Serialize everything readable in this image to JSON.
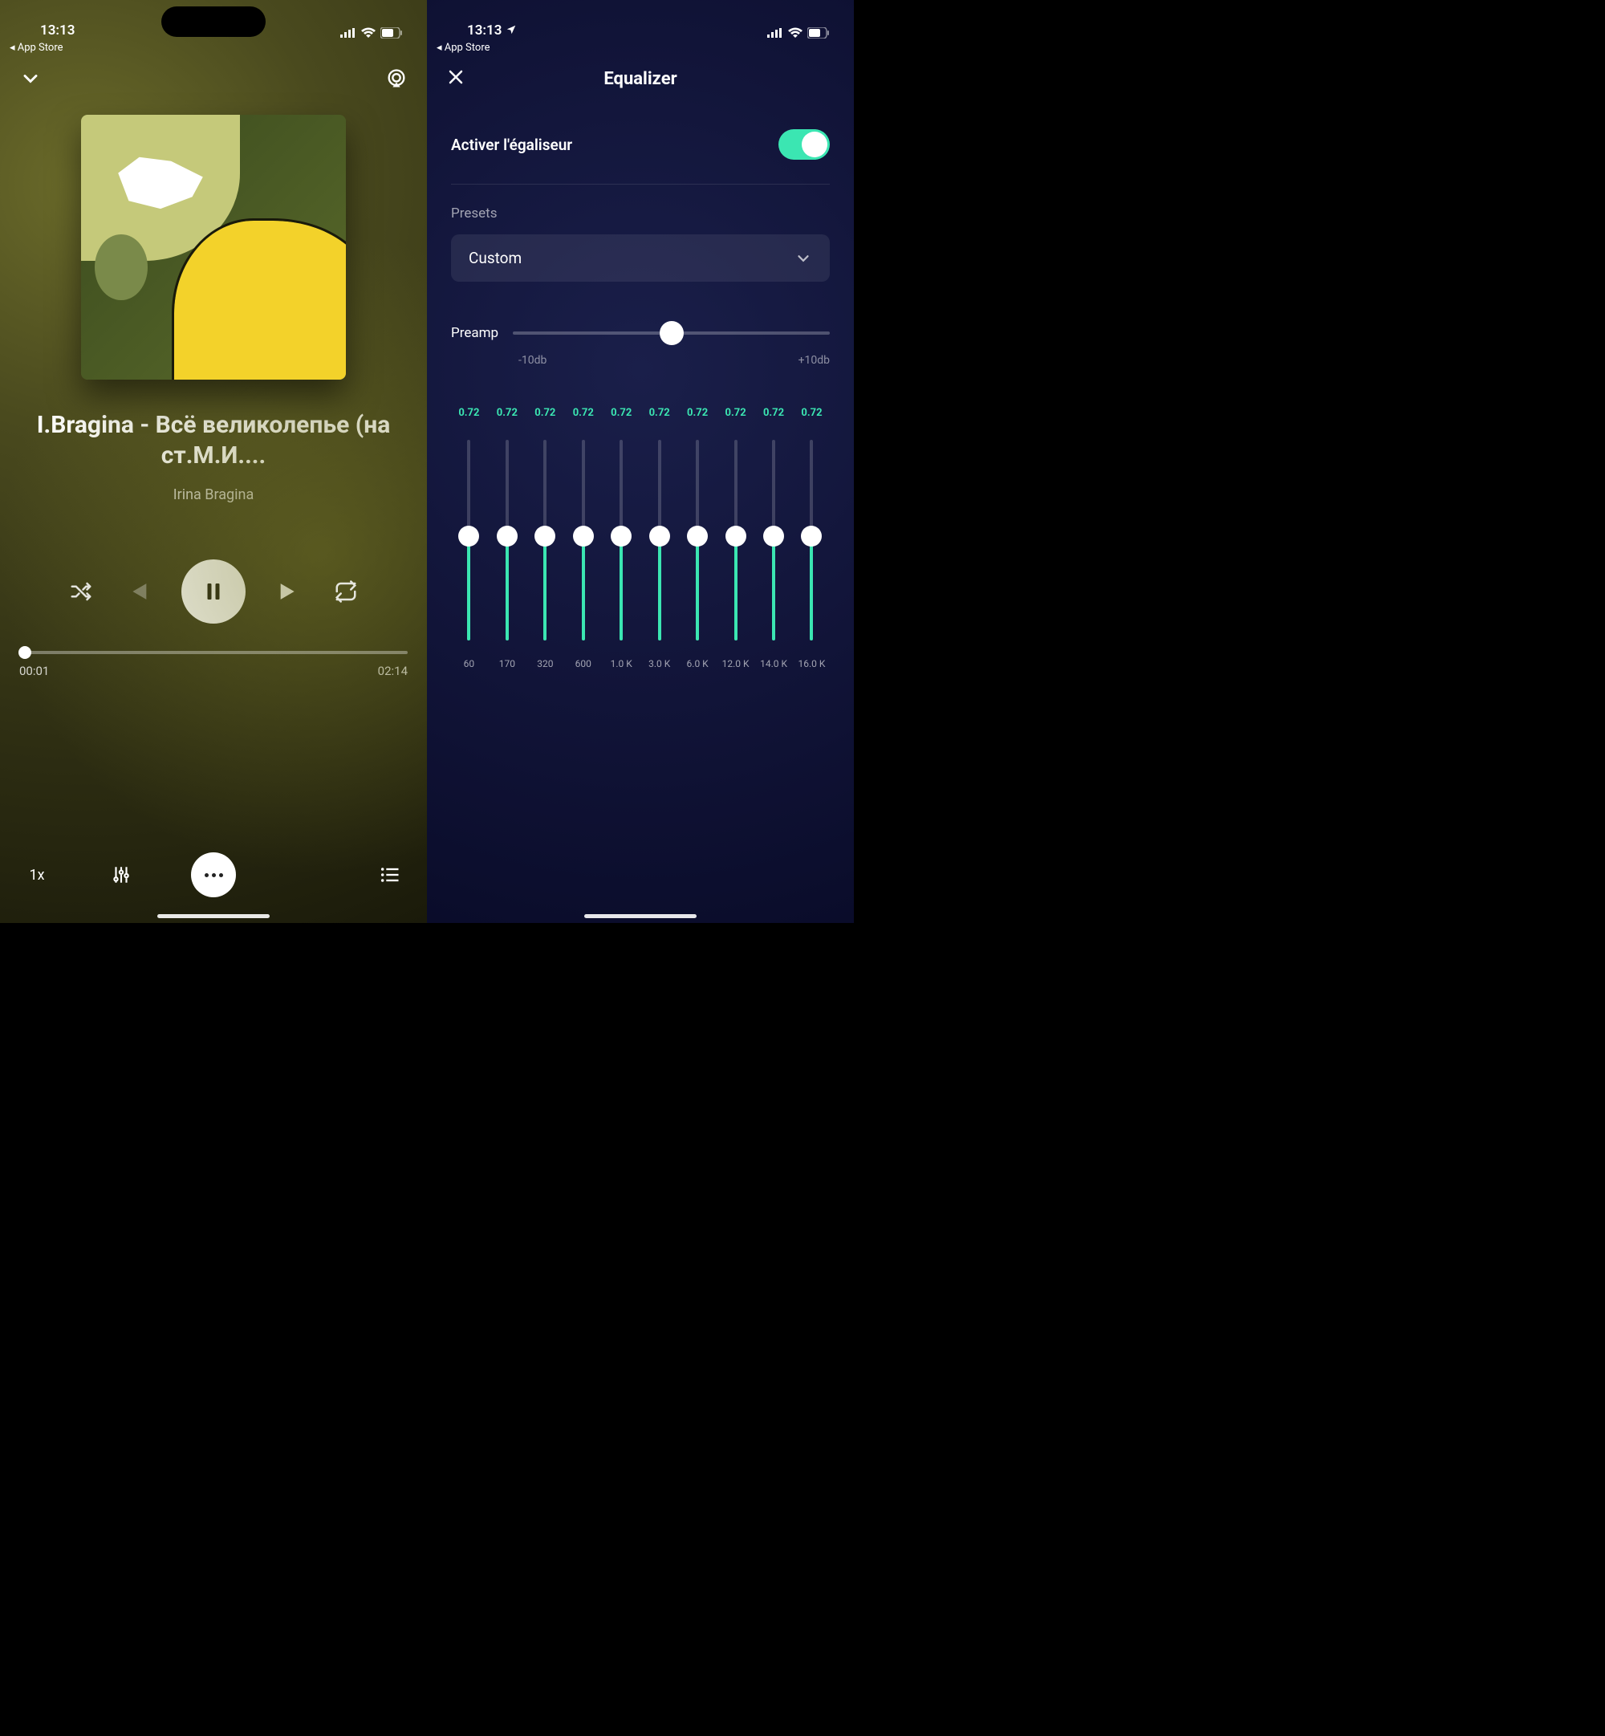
{
  "player": {
    "status": {
      "time": "13:13",
      "breadcrumb": "◂ App Store"
    },
    "track_title": "I.Bragina - Всё великолепье (на ст.М.И....",
    "artist": "Irina Bragina",
    "time_elapsed": "00:01",
    "time_total": "02:14",
    "speed_label": "1x"
  },
  "eq": {
    "status": {
      "time": "13:13",
      "breadcrumb": "◂ App Store"
    },
    "title": "Equalizer",
    "enable_label": "Activer l'égaliseur",
    "enabled": true,
    "presets_label": "Presets",
    "preset_value": "Custom",
    "preamp_label": "Preamp",
    "preamp_min": "-10db",
    "preamp_max": "+10db",
    "bands": [
      {
        "value": "0.72",
        "freq": "60"
      },
      {
        "value": "0.72",
        "freq": "170"
      },
      {
        "value": "0.72",
        "freq": "320"
      },
      {
        "value": "0.72",
        "freq": "600"
      },
      {
        "value": "0.72",
        "freq": "1.0 K"
      },
      {
        "value": "0.72",
        "freq": "3.0 K"
      },
      {
        "value": "0.72",
        "freq": "6.0 K"
      },
      {
        "value": "0.72",
        "freq": "12.0 K"
      },
      {
        "value": "0.72",
        "freq": "14.0 K"
      },
      {
        "value": "0.72",
        "freq": "16.0 K"
      }
    ]
  },
  "colors": {
    "accent": "#3be6b2"
  }
}
